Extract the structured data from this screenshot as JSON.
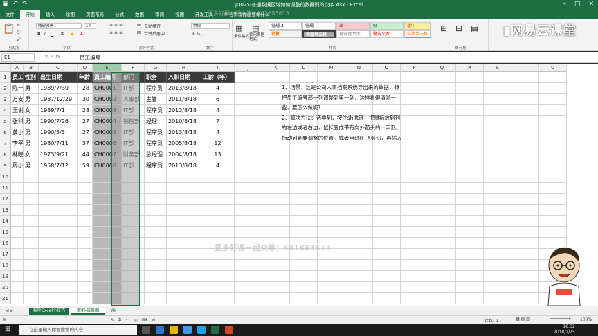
{
  "title": "JQ025-普通数据区域如何调整前数据列的次序.xlsx - Excel",
  "tabs": [
    "文件",
    "开始",
    "插入",
    "绘图",
    "页面布局",
    "公式",
    "数据",
    "审阅",
    "视图",
    "开发工具"
  ],
  "tell_me": "告诉我你想要做什么",
  "ribbon": {
    "font_name": "微软雅黑",
    "font_size": "10",
    "wrap": "自动换行",
    "merge": "合并后居中",
    "number_format": "常规",
    "cond_format": "条件格式",
    "table_format": "套用表格格式",
    "styles": [
      "常规 3",
      "常规",
      "差",
      "好",
      "适中",
      "计算",
      "检查单元格",
      "解释性文本",
      "警告文本",
      "链接单元格"
    ],
    "groups": [
      "剪贴板",
      "字体",
      "对齐方式",
      "数字",
      "样式",
      "单元格"
    ]
  },
  "logo_text": "网易云课堂",
  "namebox": "E1",
  "formula": "员工编号",
  "columns": [
    "A",
    "B",
    "C",
    "D",
    "E",
    "F",
    "G",
    "H",
    "I",
    "J",
    "K",
    "L",
    "M",
    "N",
    "O",
    "P",
    "Q",
    "R",
    "S",
    "T",
    "U"
  ],
  "rows": [
    "1",
    "2",
    "3",
    "4",
    "5",
    "6",
    "7",
    "8",
    "9",
    "10",
    "11",
    "12",
    "13",
    "14",
    "15",
    "16",
    "17",
    "18",
    "19",
    "20",
    "21"
  ],
  "table": {
    "headers": [
      "员工姓名",
      "性别",
      "出生日期",
      "年龄",
      "员工编号",
      "部门",
      "职务",
      "入职日期",
      "工龄（年）"
    ],
    "data": [
      [
        "陈一兵",
        "男",
        "1989/7/30",
        "28",
        "CH0001",
        "IT部",
        "程序员",
        "2013/8/18",
        "4"
      ],
      [
        "万安",
        "男",
        "1987/12/29",
        "30",
        "CH0002",
        "人事部",
        "主管",
        "2011/8/18",
        "6"
      ],
      [
        "王谢谢",
        "女",
        "1989/7/1",
        "28",
        "CH0003",
        "IT部",
        "程序员",
        "2013/8/18",
        "4"
      ],
      [
        "张科",
        "男",
        "1990/7/26",
        "27",
        "CH0004",
        "销售部",
        "经理",
        "2010/8/18",
        "7"
      ],
      [
        "黄小虎",
        "男",
        "1990/5/3",
        "27",
        "CH0005",
        "IT部",
        "程序员",
        "2013/8/18",
        "4"
      ],
      [
        "李平",
        "男",
        "1980/7/11",
        "37",
        "CH0006",
        "IT部",
        "程序员",
        "2005/8/18",
        "12"
      ],
      [
        "林晓彤",
        "女",
        "1973/9/21",
        "44",
        "CH0007",
        "财务部",
        "总经理",
        "2004/8/18",
        "13"
      ],
      [
        "周小花",
        "男",
        "1958/7/12",
        "59",
        "CH0008",
        "IT部",
        "程序员",
        "2013/8/18",
        "4"
      ]
    ]
  },
  "note": [
    "1、场景：这是公司人事档案系统导出来的数据，想",
    "把员工编号那一列调整到第一列，这样看得清晰一",
    "些，要怎么做呢?",
    "2、解决方法：选中列，按住shift键，把鼠标放到列",
    "的左边或者右边，鼠标变成带有向外箭头的十字形。",
    "拖动列到要调整的位置。或者用ctrl+X剪切，再插入"
  ],
  "watermark": "更多好课一起众筹：501883613",
  "sheets": [
    "秋叶Excel小技巧",
    "案例-效果图"
  ],
  "status": {
    "count": "计数: 9",
    "zoom": "100%"
  },
  "taskbar": {
    "search": "在这里输入你要搜索的内容",
    "time": "18:32",
    "date": "2018/2/25"
  },
  "colors": {
    "excel_green": "#1f6e43",
    "header_fill": "#3a3a3a",
    "selection": "#1e7145"
  }
}
